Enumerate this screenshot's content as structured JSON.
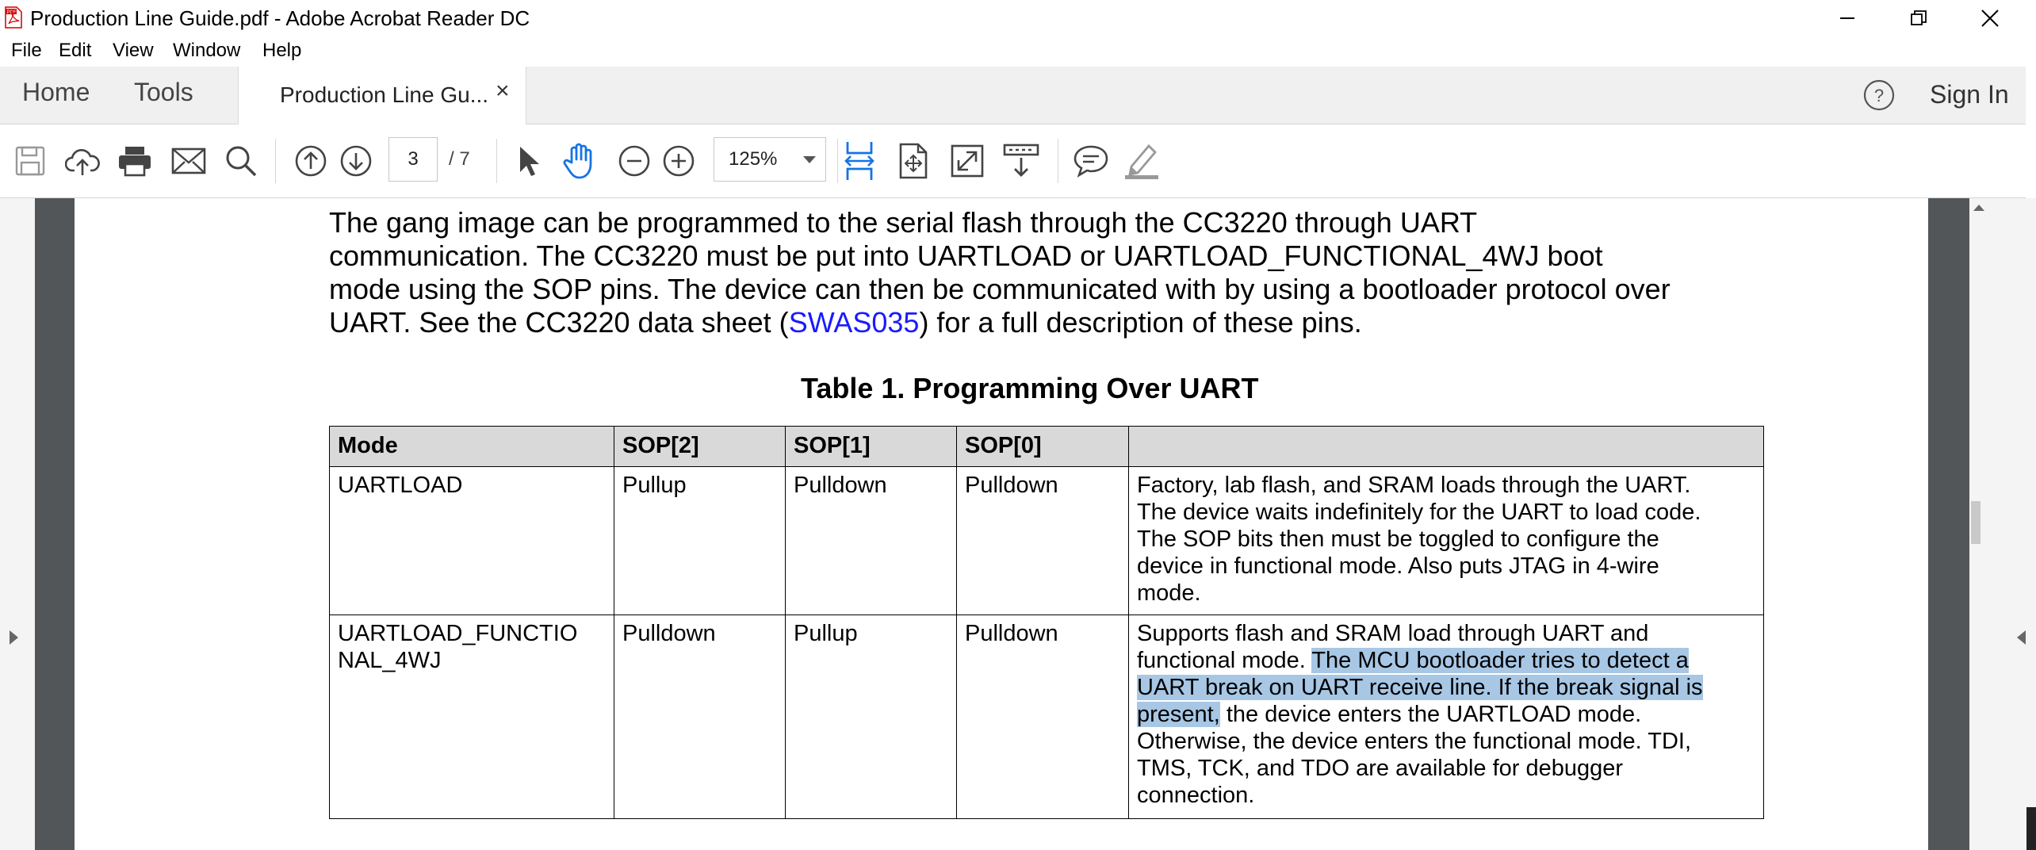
{
  "window": {
    "title": "Production Line Guide.pdf - Adobe Acrobat Reader DC",
    "logo_icon": "acrobat-pdf-icon",
    "buttons": [
      "minimize-icon",
      "restore-icon",
      "close-icon"
    ]
  },
  "menubar": {
    "items": [
      "File",
      "Edit",
      "View",
      "Window",
      "Help"
    ]
  },
  "tabs": {
    "home": "Home",
    "tools": "Tools",
    "document": "Production Line Gu...",
    "close_glyph": "×",
    "sign_in": "Sign In"
  },
  "toolbar": {
    "page_current": "3",
    "page_total": "/  7",
    "zoom": "125%",
    "icons": [
      "save-icon",
      "upload-icon",
      "print-icon",
      "email-icon",
      "search-icon",
      "page-up-icon",
      "page-down-icon",
      "select-arrow-icon",
      "hand-icon",
      "zoom-out-icon",
      "zoom-in-icon",
      "fit-width-icon",
      "fit-page-icon",
      "fullscreen-icon",
      "scroll-mode-icon",
      "comment-icon",
      "highlight-pen-icon"
    ]
  },
  "document": {
    "paragraph": {
      "line1": "The gang image can be programmed to the serial flash through the CC3220 through UART",
      "line2": "communication. The CC3220 must be put into UARTLOAD or UARTLOAD_FUNCTIONAL_4WJ boot",
      "line3": "mode using the SOP pins. The device can then be communicated with by using a bootloader protocol over",
      "line4_pre": "UART. See the CC3220 data sheet (",
      "line4_link": "SWAS035",
      "line4_post": ") for a full description of these pins."
    },
    "table": {
      "caption": "Table 1. Programming Over UART",
      "headers": [
        "Mode",
        "SOP[2]",
        "SOP[1]",
        "SOP[0]",
        ""
      ],
      "rows": [
        {
          "mode": "UARTLOAD",
          "sop2": "Pullup",
          "sop1": "Pulldown",
          "sop0": "Pulldown",
          "desc": [
            "Factory, lab flash, and SRAM loads through the UART.",
            "The device waits indefinitely for the UART to load code.",
            "The SOP bits then must be toggled to configure the",
            "device in functional mode. Also puts JTAG in 4-wire",
            "mode."
          ]
        },
        {
          "mode_l1": "UARTLOAD_FUNCTIO",
          "mode_l2": "NAL_4WJ",
          "sop2": "Pulldown",
          "sop1": "Pullup",
          "sop0": "Pulldown",
          "desc_l1": "Supports flash and SRAM load through UART and",
          "desc_l2_pre": "functional mode. ",
          "desc_l2_hl": "The MCU bootloader tries to detect a",
          "desc_l3_hl": "UART break on UART receive line. If the break signal is",
          "desc_l4_hl": "present,",
          "desc_l4_post": " the device enters the UARTLOAD mode.",
          "desc_l5": "Otherwise, the device enters the functional mode. TDI,",
          "desc_l6": "TMS, TCK, and TDO are available for debugger",
          "desc_l7": "connection."
        }
      ]
    }
  },
  "colors": {
    "link": "#1a1aff",
    "selection": "#a7c7e5",
    "active_tool": "#1473e6",
    "table_header": "#d9d9d9"
  }
}
